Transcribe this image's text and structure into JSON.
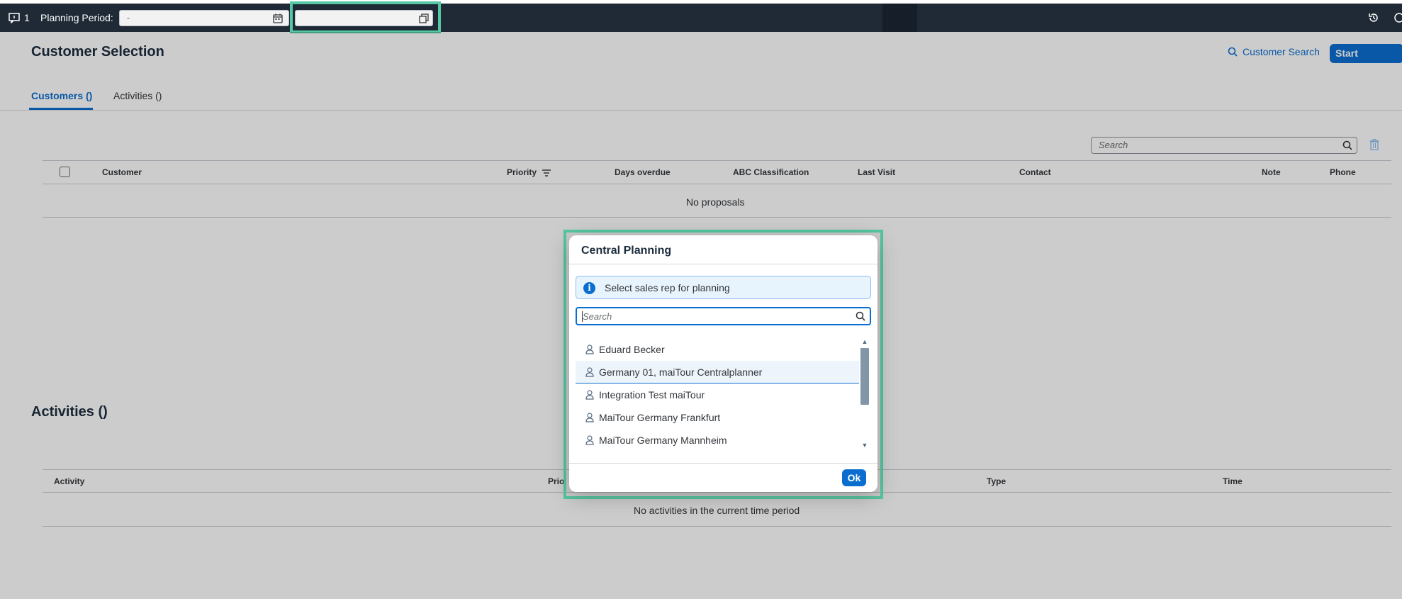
{
  "topbar": {
    "notes_count": "1",
    "planning_period_label": "Planning Period:",
    "period_value": "-",
    "second_value": ""
  },
  "page": {
    "title": "Customer Selection",
    "customer_search_label": "Customer Search",
    "start_planning_label": "Start Planning",
    "tabs": [
      {
        "label": "Customers ()"
      },
      {
        "label": "Activities ()"
      }
    ]
  },
  "customers": {
    "search_placeholder": "Search",
    "columns": [
      "Customer",
      "Priority",
      "Days overdue",
      "ABC Classification",
      "Last Visit",
      "Contact",
      "Note",
      "Phone"
    ],
    "empty_text": "No proposals"
  },
  "activities": {
    "title": "Activities ()",
    "columns": [
      "Activity",
      "Prio",
      "Type",
      "Time"
    ],
    "empty_text": "No activities in the current time period"
  },
  "dialog": {
    "title": "Central Planning",
    "info_text": "Select sales rep for planning",
    "search_placeholder": "Search",
    "items": [
      {
        "label": "Eduard Becker"
      },
      {
        "label": "Germany 01, maiTour Centralplanner"
      },
      {
        "label": "Integration Test maiTour"
      },
      {
        "label": "MaiTour Germany Frankfurt"
      },
      {
        "label": "MaiTour Germany Mannheim"
      }
    ],
    "ok_label": "Ok"
  },
  "colors": {
    "accent": "#0a6ed1",
    "topbar": "#1f2a36",
    "highlight": "#55c7a2"
  }
}
